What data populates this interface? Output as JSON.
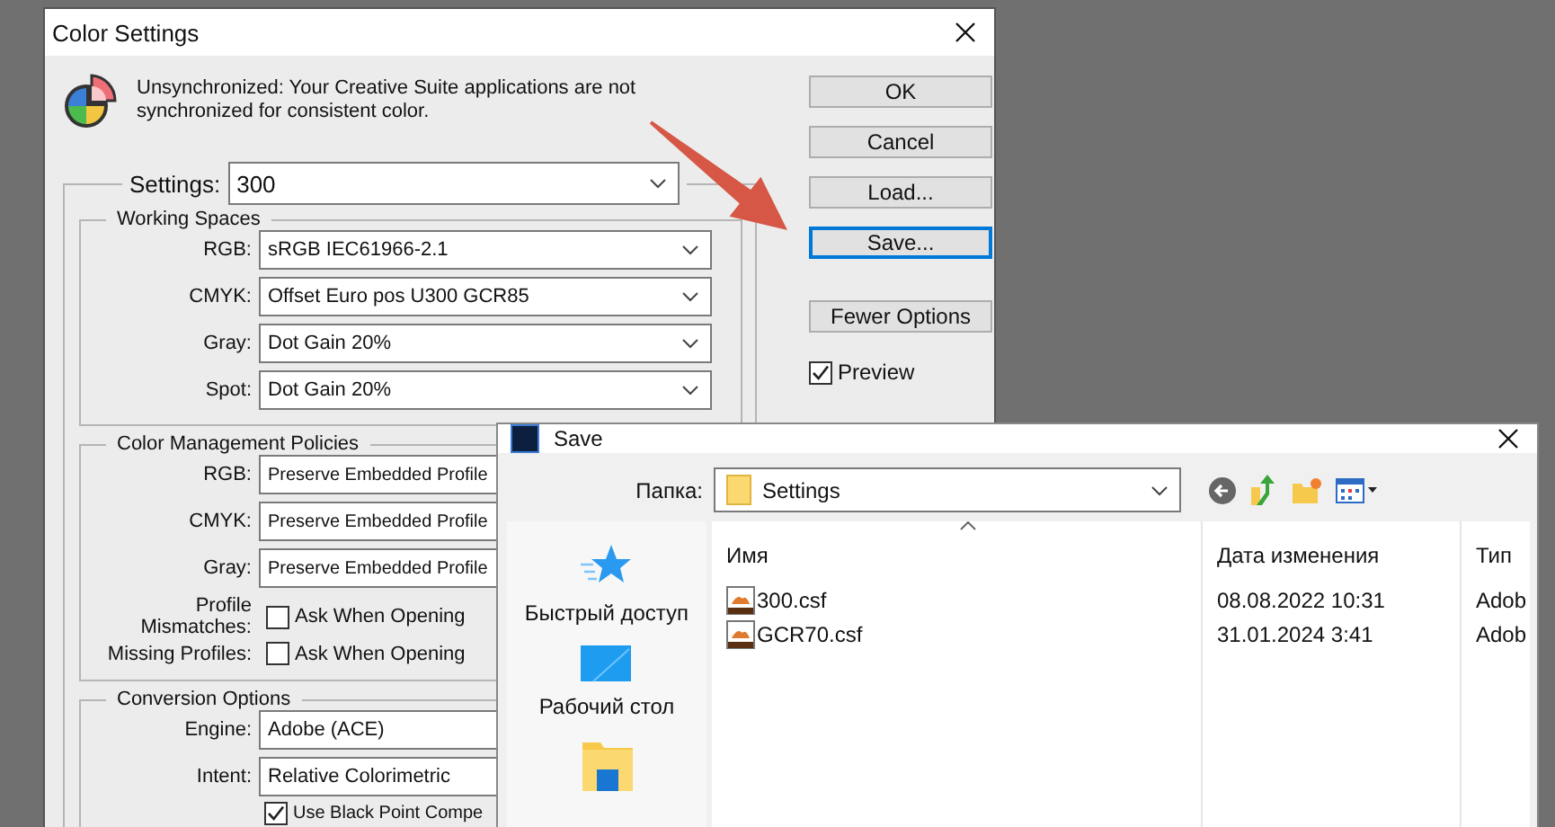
{
  "color_settings": {
    "title": "Color Settings",
    "message": "Unsynchronized: Your Creative Suite applications are not synchronized for consistent color.",
    "settings": {
      "label": "Settings:",
      "value": "300"
    },
    "working_spaces": {
      "title": "Working Spaces",
      "rows": [
        {
          "label": "RGB:",
          "value": "sRGB IEC61966-2.1"
        },
        {
          "label": "CMYK:",
          "value": "Offset Euro pos U300 GCR85"
        },
        {
          "label": "Gray:",
          "value": "Dot Gain 20%"
        },
        {
          "label": "Spot:",
          "value": "Dot Gain 20%"
        }
      ]
    },
    "policies": {
      "title": "Color Management Policies",
      "rows": [
        {
          "label": "RGB:",
          "value": "Preserve Embedded Profile"
        },
        {
          "label": "CMYK:",
          "value": "Preserve Embedded Profile"
        },
        {
          "label": "Gray:",
          "value": "Preserve Embedded Profile"
        }
      ],
      "checks": [
        {
          "label": "Profile Mismatches:",
          "option": "Ask When Opening",
          "checked": false
        },
        {
          "label": "Missing Profiles:",
          "option": "Ask When Opening",
          "checked": false
        }
      ]
    },
    "conversion": {
      "title": "Conversion Options",
      "rows": [
        {
          "label": "Engine:",
          "value": "Adobe (ACE)"
        },
        {
          "label": "Intent:",
          "value": "Relative Colorimetric"
        }
      ],
      "checks": [
        {
          "label": "Use Black Point Compe",
          "checked": true
        }
      ]
    },
    "buttons": [
      {
        "label": "OK",
        "focused": false
      },
      {
        "label": "Cancel",
        "focused": false
      },
      {
        "label": "Load...",
        "focused": false
      },
      {
        "label": "Save...",
        "focused": true
      },
      {
        "label": "Fewer Options",
        "focused": false
      }
    ],
    "preview": {
      "label": "Preview",
      "checked": true
    }
  },
  "save_dialog": {
    "title": "Save",
    "folder_label": "Папка:",
    "folder": "Settings",
    "places": [
      {
        "kind": "star",
        "label": "Быстрый доступ"
      },
      {
        "kind": "desktop",
        "label": "Рабочий стол"
      },
      {
        "kind": "folder"
      }
    ],
    "columns": [
      "Имя",
      "Дата изменения",
      "Тип"
    ],
    "files": [
      {
        "name": "300.csf",
        "date": "08.08.2022 10:31",
        "type": "Adob"
      },
      {
        "name": "GCR70.csf",
        "date": "31.01.2024 3:41",
        "type": "Adob"
      }
    ]
  }
}
